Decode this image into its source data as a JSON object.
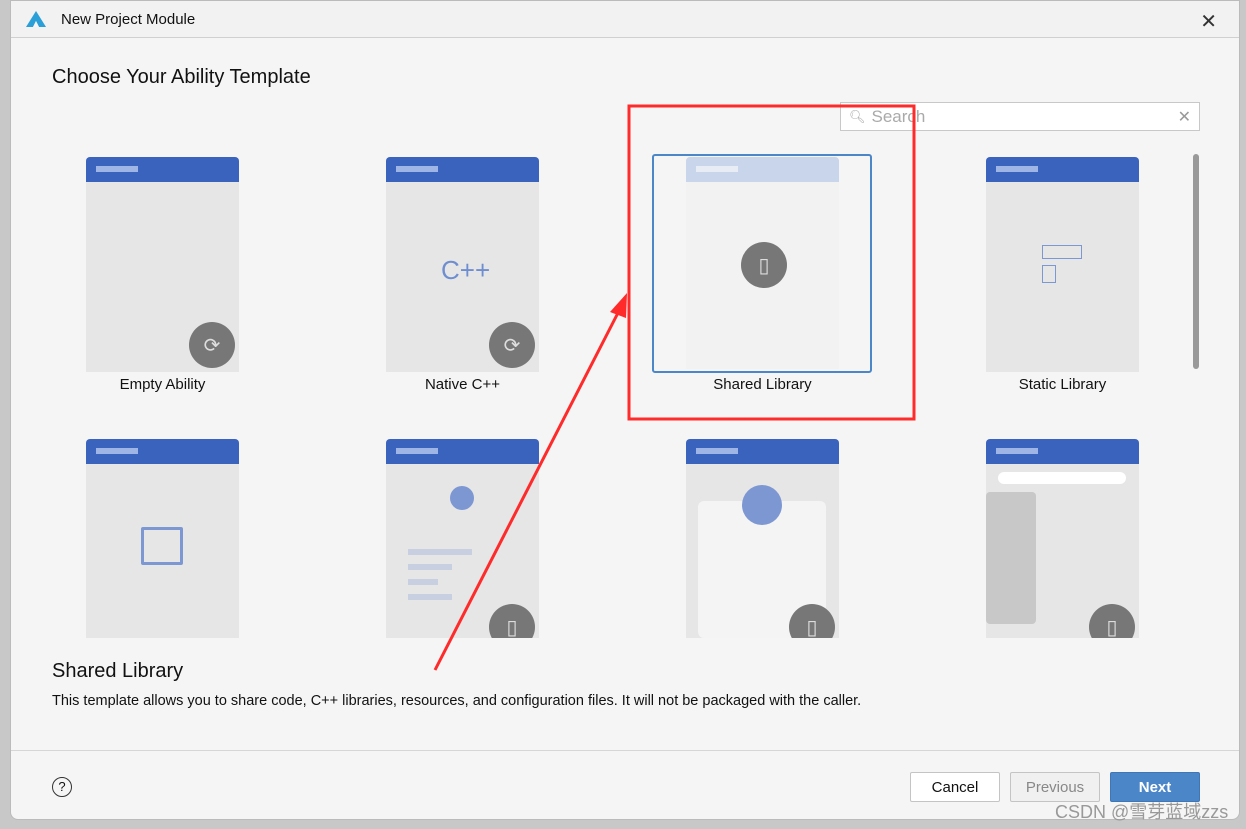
{
  "window": {
    "title": "New Project Module",
    "close_icon": "close-icon"
  },
  "heading": "Choose Your Ability Template",
  "search": {
    "placeholder": "Search",
    "value": ""
  },
  "templates": [
    {
      "label": "Empty Ability",
      "selected": false
    },
    {
      "label": "Native C++",
      "selected": false
    },
    {
      "label": "Shared Library",
      "selected": true
    },
    {
      "label": "Static Library",
      "selected": false
    },
    {
      "label": "",
      "selected": false
    },
    {
      "label": "",
      "selected": false
    },
    {
      "label": "",
      "selected": false
    },
    {
      "label": "",
      "selected": false
    }
  ],
  "cpp_glyph": "C++",
  "description": {
    "title": "Shared Library",
    "text": "This template allows you to share code, C++ libraries, resources, and configuration files. It will not be packaged with the caller."
  },
  "buttons": {
    "cancel": "Cancel",
    "previous": "Previous",
    "next": "Next"
  },
  "watermark": "CSDN @雪芽蓝域zzs",
  "colors": {
    "accent": "#4a86c8",
    "next_button": "#4a86c8",
    "card_header": "#3a63be",
    "annotation": "#ff2a2a"
  }
}
